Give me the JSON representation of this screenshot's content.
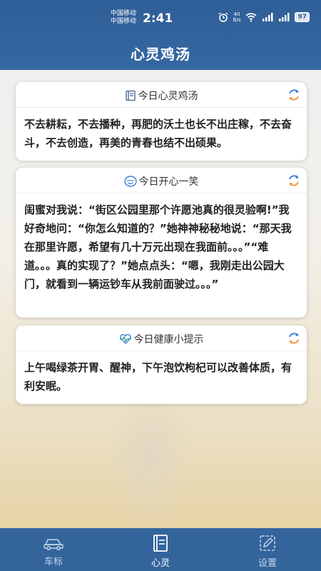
{
  "status": {
    "carrier1": "中国移动",
    "carrier2": "中国移动",
    "time": "2:41",
    "speed_value": "40",
    "speed_unit": "B/s",
    "battery": "97"
  },
  "app_title": "心灵鸡汤",
  "cards": [
    {
      "title": "今日心灵鸡汤",
      "icon": "book-icon",
      "body": "不去耕耘，不去播种，再肥的沃土也长不出庄稼，不去奋斗，不去创造，再美的青春也结不出硕果。"
    },
    {
      "title": "今日开心一笑",
      "icon": "smile-icon",
      "body": "闺蜜对我说：“街区公园里那个许愿池真的很灵验啊!”我好奇地问：“你怎么知道的？”她神神秘秘地说：“那天我在那里许愿，希望有几十万元出现在我面前。。。”“难道。。。真的实现了？”她点点头：“嗯，我刚走出公园大门，就看到一辆运钞车从我前面驶过。。。”"
    },
    {
      "title": "今日健康小提示",
      "icon": "heartbeat-icon",
      "body": "上午喝绿茶开胃、醒神，下午泡饮枸杞可以改善体质，有利安眠。"
    }
  ],
  "nav": [
    {
      "label": "车标",
      "icon": "car-icon",
      "active": false
    },
    {
      "label": "心灵",
      "icon": "notebook-icon",
      "active": true
    },
    {
      "label": "设置",
      "icon": "settings-edit-icon",
      "active": false
    }
  ],
  "colors": {
    "header": "#3567a2",
    "nav": "#33649c",
    "refresh_blue": "#3b82d6",
    "refresh_orange": "#f0953a"
  }
}
